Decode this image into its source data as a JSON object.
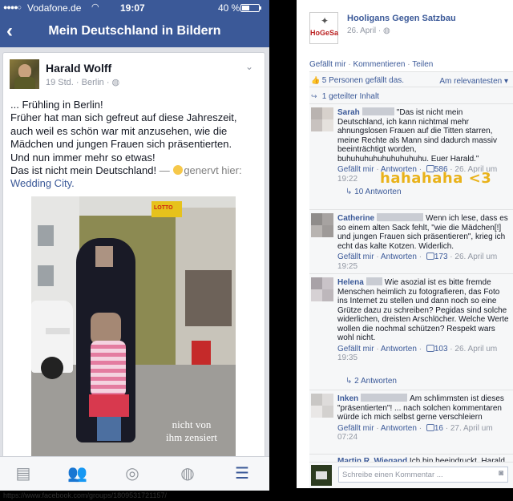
{
  "mobile": {
    "status": {
      "carrier": "Vodafone.de",
      "time": "19:07",
      "battery": "40 %"
    },
    "nav": {
      "back": "‹",
      "title": "Mein Deutschland in Bildern"
    },
    "post": {
      "author": "Harald Wolff",
      "meta": "19 Std. · Berlin · ",
      "lines": [
        "... Frühling in Berlin!",
        "Früher hat man sich gefreut auf diese Jahreszeit,",
        "auch weil es schön war mit anzusehen, wie die",
        "Mädchen und jungen Frauen sich präsentierten.",
        "Und nun immer mehr so etwas!",
        "Das ist nicht mein Deutschland!"
      ],
      "feeling_prefix": " — ",
      "feeling": "genervt hier:",
      "location": "Wedding City.",
      "photo": {
        "sign": "LOTTO",
        "watermark_1": "nicht von",
        "watermark_2": "ihm zensiert"
      }
    },
    "tabs": [
      {
        "name": "news-feed-icon",
        "glyph": "▤"
      },
      {
        "name": "friends-icon",
        "glyph": "👥"
      },
      {
        "name": "messenger-icon",
        "glyph": "◎"
      },
      {
        "name": "globe-icon",
        "glyph": "◍"
      },
      {
        "name": "menu-icon",
        "glyph": "☰"
      }
    ]
  },
  "url": "https://www.facebook.com/groups/1809531721157/",
  "desktop": {
    "page": {
      "name": "Hooligans Gegen Satzbau",
      "date": "26. April · ",
      "logo_text": "HoGeSa"
    },
    "actions": [
      "Gefällt mir",
      "Kommentieren",
      "Teilen"
    ],
    "likes": "5 Personen gefällt das.",
    "sort": "Am relevantesten ▾",
    "shares": "1 geteilter Inhalt",
    "annotation": "hahahaha <3",
    "comments": [
      {
        "name": "Sarah",
        "text": "\"Das ist nicht mein Deutschland, ich kann nichtmal mehr ahnungslosen Frauen auf die Titten starren, meine Rechte als Mann sind dadurch massiv beeinträchtigt worden, buhuhuhuhuhuhuhuhuhu. Euer Harald.\"",
        "like": "Gefällt mir",
        "reply": "Antworten",
        "likes": "586",
        "date": "26. April um 19:22",
        "replies": "10 Antworten"
      },
      {
        "name": "Catherine",
        "text": "Wenn ich lese, dass es so einem alten Sack fehlt, \"wie die Mädchen[!] und jungen Frauen sich präsentieren\", krieg ich echt das kalte Kotzen. Widerlich.",
        "like": "Gefällt mir",
        "reply": "Antworten",
        "likes": "173",
        "date": "26. April um 19:25"
      },
      {
        "name": "Helena",
        "text": "Wie asozial ist es bitte fremde Menschen heimlich zu fotografieren, das Foto ins Internet zu stellen und dann noch so eine Grütze dazu zu schreiben? Pegidas sind solche widerlichen, dreisten Arschlöcher. Welche Werte wollen die nochmal schützen? Respekt wars wohl nicht.",
        "like": "Gefällt mir",
        "reply": "Antworten",
        "likes": "103",
        "date": "26. April um 19:35",
        "replies": "2 Antworten"
      },
      {
        "name": "Inken",
        "text": "Am schlimmsten ist dieses \"präsentierten\"! ... nach solchen kommentaren würde ich mich selbst gerne verschleiern",
        "like": "Gefällt mir",
        "reply": "Antworten",
        "likes": "16",
        "date": "27. April um 07:24"
      },
      {
        "name": "Martin R. Wiegand",
        "text": "Ich bin beeindruckt. Harald"
      }
    ],
    "write_placeholder": "Schreibe einen Kommentar ..."
  }
}
